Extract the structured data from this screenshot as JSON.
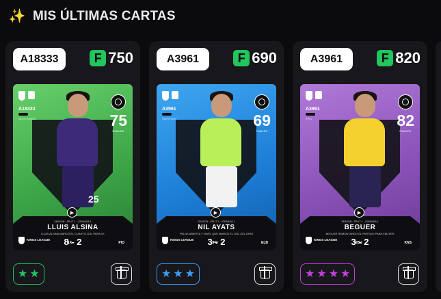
{
  "section": {
    "title": "MIS ÚLTIMAS CARTAS",
    "icon": "sparkles-icon",
    "accent": "#f5c542"
  },
  "cards": [
    {
      "code": "A18333",
      "price": "750",
      "currency_icon": "f-coin-icon",
      "card_code": "A18333",
      "card_type": "ORO COMÚN",
      "rating": "75",
      "rating_label": "FINALES",
      "jersey_number": "25",
      "band_meta": "SEASON · SPLIT 1 · JORNADA 1",
      "name": "LLUIS ALSINA",
      "desc": "LLUIS ALSINA MARCÓ EL CUARTO GOL PARA 1K",
      "league": "KINGS LEAGUE",
      "home": "1K",
      "score": "8 - 2",
      "away": "PIO",
      "stars": 2,
      "color": "green",
      "accent": "#22c55e"
    },
    {
      "code": "A3961",
      "price": "690",
      "currency_icon": "f-coin-icon",
      "card_code": "A3961",
      "card_type": "SUPERIOR",
      "rating": "69",
      "rating_label": "FINALES",
      "jersey_number": "",
      "band_meta": "SEASON · SPLIT 1 · JORNADA 1",
      "name": "NIL AYATS",
      "desc": "PELAS ABIERTA Y NIVEL QUE MARCÓ EL GOL DEL DIRO",
      "league": "KINGS LEAGUE",
      "home": "JFC",
      "score": "3 - 2",
      "away": "ELB",
      "stars": 3,
      "color": "blue",
      "accent": "#3b9cf5"
    },
    {
      "code": "A3961",
      "price": "820",
      "currency_icon": "f-coin-icon",
      "card_code": "A3961",
      "card_type": "ÉPIC",
      "rating": "82",
      "rating_label": "FINALES",
      "jersey_number": "",
      "band_meta": "SEASON · SPLIT 1 · JORNADA 1",
      "name": "BEGUER",
      "desc": "BEGUER REMONTANDO EL PARTIDO PARA XBUYER",
      "league": "KINGS LEAGUE",
      "home": "XBU",
      "score": "3 - 2",
      "away": "KNS",
      "stars": 4,
      "color": "purple",
      "accent": "#c43fe0"
    }
  ],
  "icons": {
    "gift": "gift-icon",
    "target": "target-icon",
    "play": "play-icon"
  },
  "glyphs": {
    "star": "★",
    "play": "▶",
    "sparkle": "✨"
  }
}
